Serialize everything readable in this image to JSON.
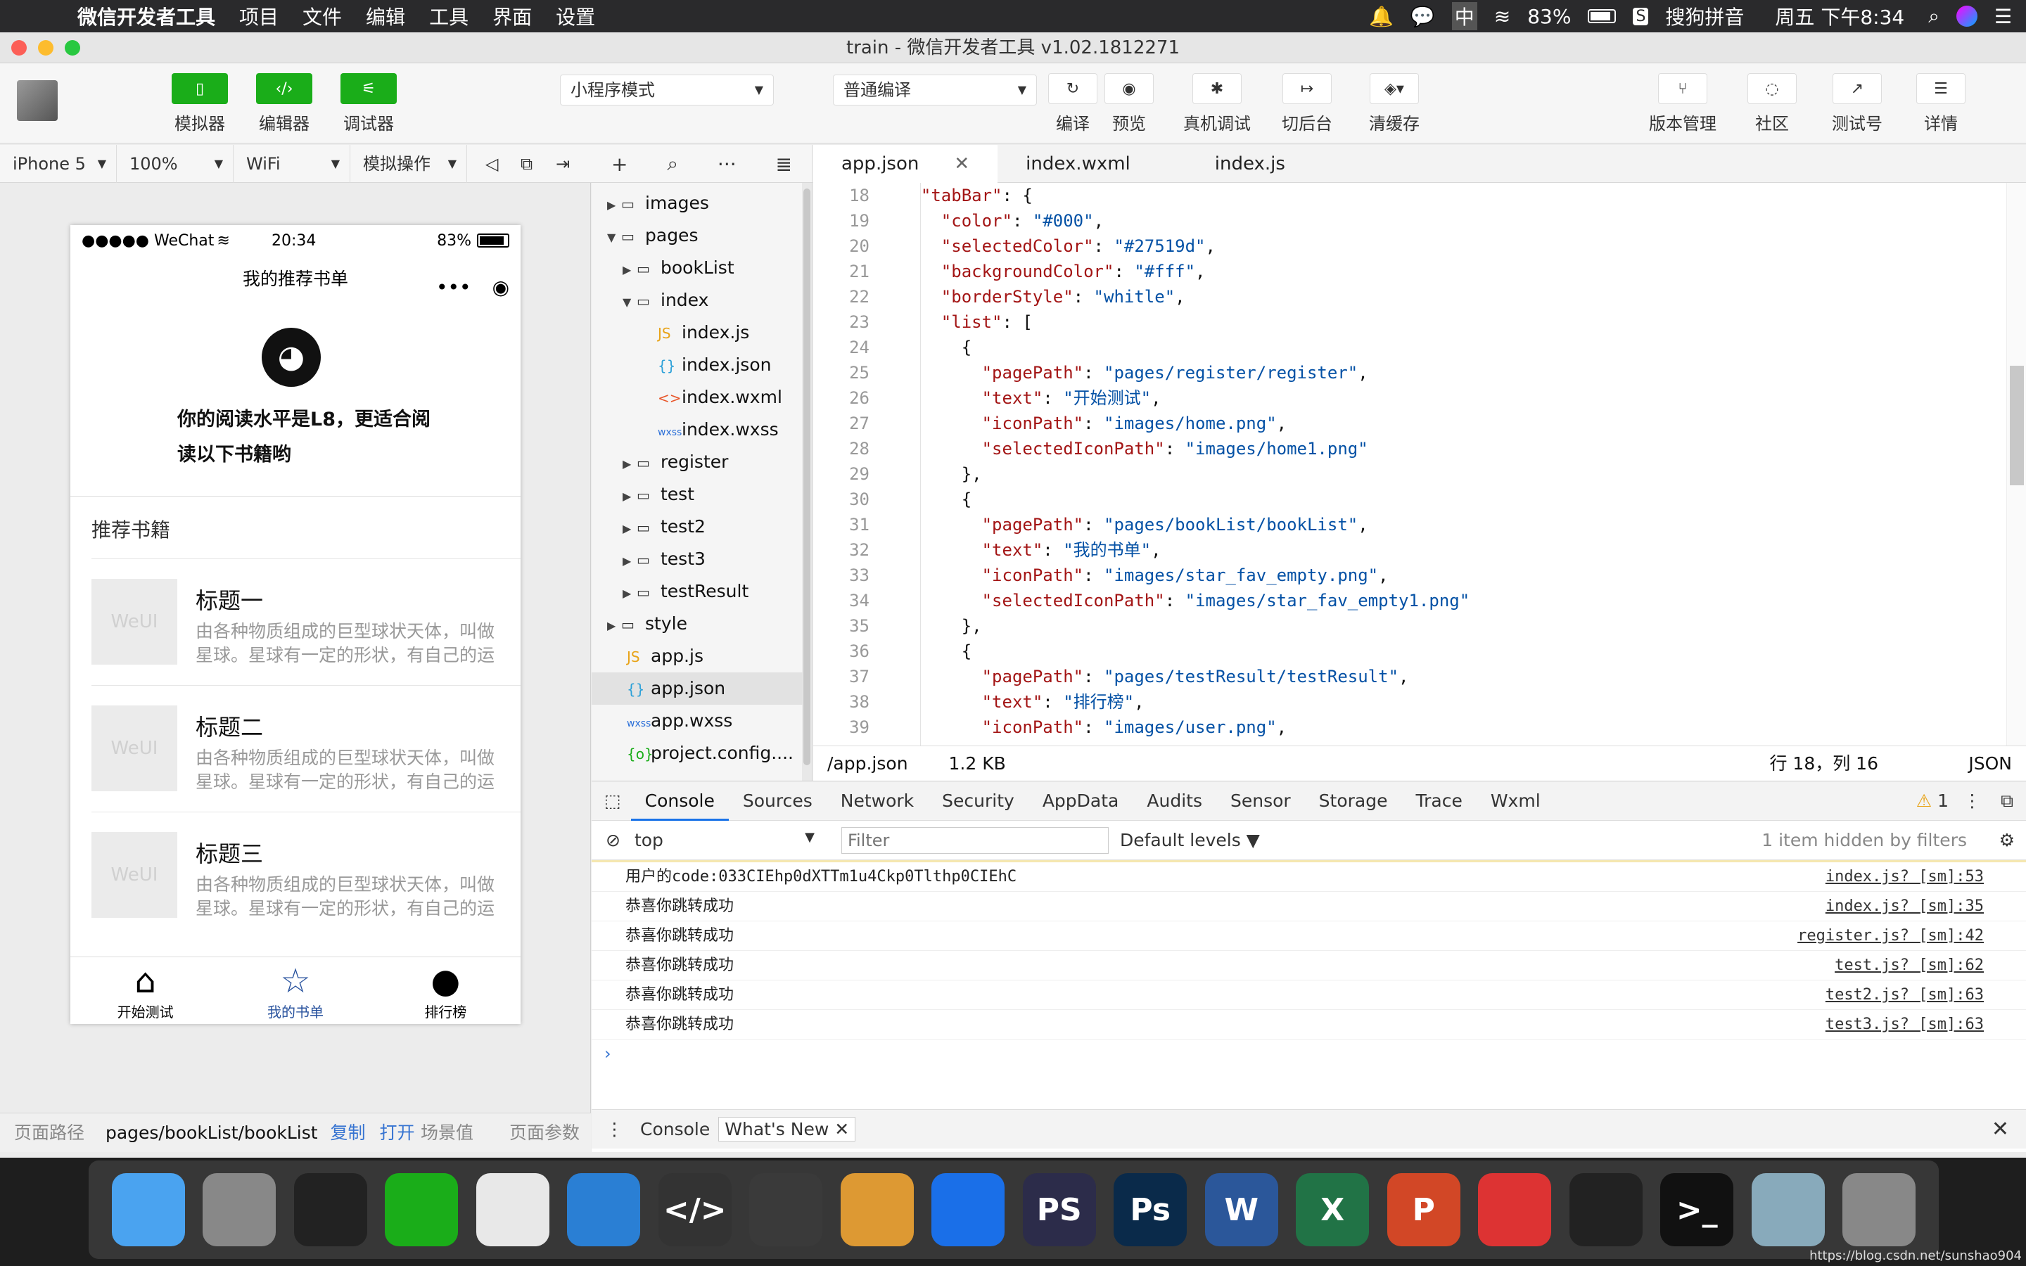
{
  "menubar": {
    "app_name": "微信开发者工具",
    "items": [
      "项目",
      "文件",
      "编辑",
      "工具",
      "界面",
      "设置"
    ],
    "battery": "83%",
    "input_method": "搜狗拼音",
    "clock": "周五 下午8:34",
    "input_char": "中"
  },
  "window": {
    "title": "train - 微信开发者工具 v1.02.1812271"
  },
  "toolbar": {
    "simulator": "模拟器",
    "editor": "编辑器",
    "debugger": "调试器",
    "mode_select": "小程序模式",
    "compile_select": "普通编译",
    "compile": "编译",
    "preview": "预览",
    "remote_debug": "真机调试",
    "background": "切后台",
    "clear_cache": "清缓存",
    "version": "版本管理",
    "community": "社区",
    "test_account": "测试号",
    "details": "详情"
  },
  "sim_controls": {
    "device": "iPhone 5",
    "zoom": "100%",
    "network": "WiFi",
    "operation": "模拟操作"
  },
  "phone": {
    "carrier": "●●●●● WeChat",
    "time": "20:34",
    "battery": "83%",
    "nav_title": "我的推荐书单",
    "level_text": "你的阅读水平是L8，更适合阅读以下书籍哟",
    "section_title": "推荐书籍",
    "thumb_text": "WeUI",
    "books": [
      {
        "title": "标题一",
        "desc": "由各种物质组成的巨型球状天体，叫做星球。星球有一定的形状，有自己的运行轨道。"
      },
      {
        "title": "标题二",
        "desc": "由各种物质组成的巨型球状天体，叫做星球。星球有一定的形状，有自己的运行轨道。"
      },
      {
        "title": "标题三",
        "desc": "由各种物质组成的巨型球状天体，叫做星球。星球有一定的形状，有自己的运行轨道。"
      }
    ],
    "tabs": [
      "开始测试",
      "我的书单",
      "排行榜"
    ]
  },
  "sim_footer": {
    "path_label": "页面路径",
    "path": "pages/bookList/bookList",
    "copy": "复制",
    "open": "打开",
    "scene": "场景值",
    "params": "页面参数"
  },
  "tree": {
    "items": [
      {
        "name": "images",
        "kind": "folder",
        "arrow": "▶"
      },
      {
        "name": "pages",
        "kind": "folder-open",
        "arrow": "▼"
      },
      {
        "name": "bookList",
        "kind": "folder",
        "arrow": "▶"
      },
      {
        "name": "index",
        "kind": "folder-open",
        "arrow": "▼"
      },
      {
        "name": "index.js",
        "kind": "js",
        "arrow": ""
      },
      {
        "name": "index.json",
        "kind": "json",
        "arrow": ""
      },
      {
        "name": "index.wxml",
        "kind": "wxml",
        "arrow": ""
      },
      {
        "name": "index.wxss",
        "kind": "wxss",
        "arrow": ""
      },
      {
        "name": "register",
        "kind": "folder",
        "arrow": "▶"
      },
      {
        "name": "test",
        "kind": "folder",
        "arrow": "▶"
      },
      {
        "name": "test2",
        "kind": "folder",
        "arrow": "▶"
      },
      {
        "name": "test3",
        "kind": "folder",
        "arrow": "▶"
      },
      {
        "name": "testResult",
        "kind": "folder",
        "arrow": "▶"
      },
      {
        "name": "style",
        "kind": "folder",
        "arrow": "▶"
      },
      {
        "name": "app.js",
        "kind": "js",
        "arrow": ""
      },
      {
        "name": "app.json",
        "kind": "json",
        "arrow": ""
      },
      {
        "name": "app.wxss",
        "kind": "wxss",
        "arrow": ""
      },
      {
        "name": "project.config....",
        "kind": "config",
        "arrow": ""
      }
    ]
  },
  "editor": {
    "tabs": [
      "app.json",
      "index.wxml",
      "index.js"
    ],
    "line_numbers": [
      "18",
      "19",
      "20",
      "21",
      "22",
      "23",
      "24",
      "25",
      "26",
      "27",
      "28",
      "29",
      "30",
      "31",
      "32",
      "33",
      "34",
      "35",
      "36",
      "37",
      "38",
      "39"
    ],
    "lines": [
      "  \"tabBar\": {",
      "    \"color\": \"#000\",",
      "    \"selectedColor\": \"#27519d\",",
      "    \"backgroundColor\": \"#fff\",",
      "    \"borderStyle\": \"whitle\",",
      "    \"list\": [",
      "      {",
      "        \"pagePath\": \"pages/register/register\",",
      "        \"text\": \"开始测试\",",
      "        \"iconPath\": \"images/home.png\",",
      "        \"selectedIconPath\": \"images/home1.png\"",
      "      },",
      "      {",
      "        \"pagePath\": \"pages/bookList/bookList\",",
      "        \"text\": \"我的书单\",",
      "        \"iconPath\": \"images/star_fav_empty.png\",",
      "        \"selectedIconPath\": \"images/star_fav_empty1.png\"",
      "      },",
      "      {",
      "        \"pagePath\": \"pages/testResult/testResult\",",
      "        \"text\": \"排行榜\",",
      "        \"iconPath\": \"images/user.png\","
    ],
    "status_path": "/app.json",
    "status_size": "1.2 KB",
    "status_cursor": "行 18，列 16",
    "status_lang": "JSON"
  },
  "devtools": {
    "tabs": [
      "Console",
      "Sources",
      "Network",
      "Security",
      "AppData",
      "Audits",
      "Sensor",
      "Storage",
      "Trace",
      "Wxml"
    ],
    "warn_count": "1",
    "context": "top",
    "filter_placeholder": "Filter",
    "levels": "Default levels",
    "hidden_note": "1 item hidden by filters",
    "logs": [
      {
        "msg": "用户的code:033CIEhp0dXTTm1u4Ckp0Tlthp0CIEhC",
        "src": "index.js? [sm]:53"
      },
      {
        "msg": "恭喜你跳转成功",
        "src": "index.js? [sm]:35"
      },
      {
        "msg": "恭喜你跳转成功",
        "src": "register.js? [sm]:42"
      },
      {
        "msg": "恭喜你跳转成功",
        "src": "test.js? [sm]:62"
      },
      {
        "msg": "恭喜你跳转成功",
        "src": "test2.js? [sm]:63"
      },
      {
        "msg": "恭喜你跳转成功",
        "src": "test3.js? [sm]:63"
      }
    ],
    "drawer_console": "Console",
    "drawer_whatsnew": "What's New"
  },
  "dock": [
    "Finder",
    "System Preferences",
    "QQ",
    "WeChat",
    "Chrome",
    "VS Code",
    "WeChat DevTools",
    "Sublime Text",
    "Photo",
    "Video",
    "PhpStorm",
    "Photoshop",
    "Word",
    "Excel",
    "PowerPoint",
    "NetEase Music",
    "Activity Monitor",
    "Terminal",
    "Preview",
    "Trash"
  ],
  "dock_labels": [
    "",
    "",
    "",
    "",
    "",
    "",
    "</>",
    "",
    "",
    "",
    "PS",
    "Ps",
    "W",
    "X",
    "P",
    "",
    "",
    ">_",
    "",
    ""
  ],
  "watermark": "https://blog.csdn.net/sunshao904"
}
